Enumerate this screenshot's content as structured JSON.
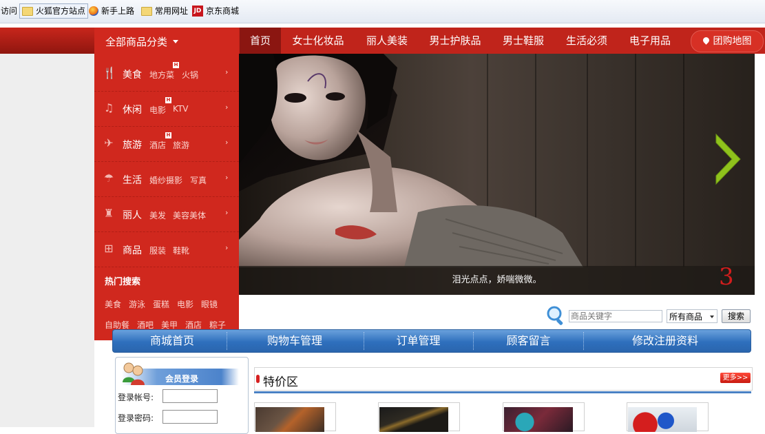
{
  "bookmarks": {
    "items": [
      {
        "label": "访问",
        "icon": "none"
      },
      {
        "label": "火狐官方站点",
        "icon": "folder-icon"
      },
      {
        "label": "新手上路",
        "icon": "firefox-icon"
      },
      {
        "label": "常用网址",
        "icon": "folder-icon"
      },
      {
        "label": "京东商城",
        "icon": "jd-icon",
        "icon_text": "JD"
      }
    ]
  },
  "nav": {
    "all_categories": "全部商品分类",
    "items": [
      "首页",
      "女士化妆品",
      "丽人美装",
      "男士护肤品",
      "男士鞋服",
      "生活必须",
      "电子用品"
    ],
    "active": "首页",
    "map_button": "团购地图"
  },
  "categories": [
    {
      "name": "美食",
      "icon": "utensils-icon",
      "subs": [
        "地方菜",
        "火锅"
      ],
      "badge": "H"
    },
    {
      "name": "休闲",
      "icon": "music-note-icon",
      "subs": [
        "电影",
        "KTV"
      ],
      "badge": "H"
    },
    {
      "name": "旅游",
      "icon": "airplane-icon",
      "subs": [
        "酒店",
        "旅游"
      ],
      "badge": "H"
    },
    {
      "name": "生活",
      "icon": "umbrella-icon",
      "subs": [
        "婚纱摄影",
        "写真"
      ]
    },
    {
      "name": "丽人",
      "icon": "perfume-icon",
      "subs": [
        "美发",
        "美容美体"
      ]
    },
    {
      "name": "商品",
      "icon": "basket-icon",
      "subs": [
        "服装",
        "鞋靴"
      ]
    }
  ],
  "hot_search": {
    "title": "热门搜索",
    "terms": [
      "美食",
      "游泳",
      "蛋糕",
      "电影",
      "眼镜",
      "自助餐",
      "酒吧",
      "美甲",
      "酒店",
      "粽子"
    ]
  },
  "banner": {
    "caption": "泪光点点，娇喘微微。",
    "slide_number": "3"
  },
  "search": {
    "placeholder": "商品关键字",
    "category_selected": "所有商品",
    "button": "搜索"
  },
  "main_menu": [
    "商城首页",
    "购物车管理",
    "订单管理",
    "顾客留言",
    "修改注册资料"
  ],
  "member_login": {
    "title": "会员登录",
    "account_label": "登录帐号:",
    "password_label": "登录密码:"
  },
  "special": {
    "title": "特价区",
    "more": "更多>>"
  },
  "colors": {
    "nav_red": "#c0241b",
    "menu_red": "#d0281e",
    "active_dark": "#8b1611",
    "menu_blue": "#2e6fbd"
  }
}
